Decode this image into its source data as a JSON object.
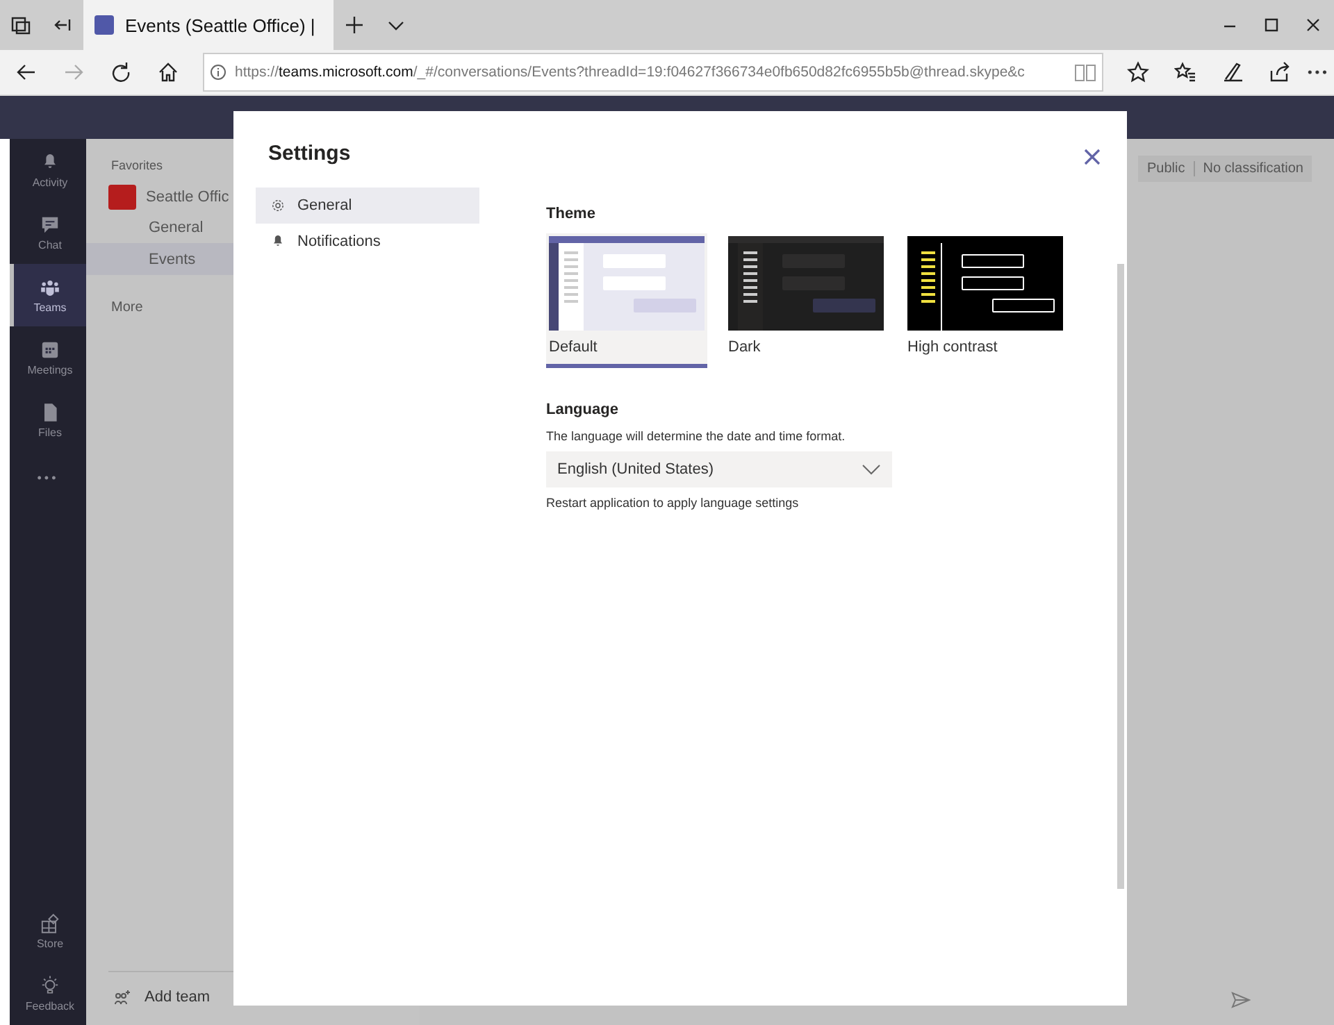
{
  "browser": {
    "tab_title": "Events (Seattle Office) |",
    "url": "https://**teams.microsoft.com**/_#/conversations/Events?threadId=19:f04627f366734e0fb650d82fc6955b5b@thread.skype&c"
  },
  "rail": [
    {
      "label": "Activity",
      "selected": false
    },
    {
      "label": "Chat",
      "selected": false
    },
    {
      "label": "Teams",
      "selected": true
    },
    {
      "label": "Meetings",
      "selected": false
    },
    {
      "label": "Files",
      "selected": false
    }
  ],
  "rail_more": "•••",
  "rail_bottom": [
    {
      "label": "Store"
    },
    {
      "label": "Feedback"
    }
  ],
  "channels": {
    "heading": "Favorites",
    "team": "Seattle Offic",
    "items": [
      {
        "label": "General",
        "selected": false
      },
      {
        "label": "Events",
        "selected": true
      }
    ],
    "more": "More",
    "add_team": "Add team"
  },
  "tags": [
    "Public",
    "No classification"
  ],
  "settings": {
    "title": "Settings",
    "nav": [
      {
        "label": "General",
        "selected": true
      },
      {
        "label": "Notifications",
        "selected": false
      }
    ],
    "theme_heading": "Theme",
    "themes": [
      {
        "label": "Default",
        "kind": "default",
        "selected": true
      },
      {
        "label": "Dark",
        "kind": "dark",
        "selected": false
      },
      {
        "label": "High contrast",
        "kind": "contrast",
        "selected": false
      }
    ],
    "language_heading": "Language",
    "language_hint": "The language will determine the date and time format.",
    "language_value": "English (United States)",
    "language_note": "Restart application to apply language settings"
  }
}
